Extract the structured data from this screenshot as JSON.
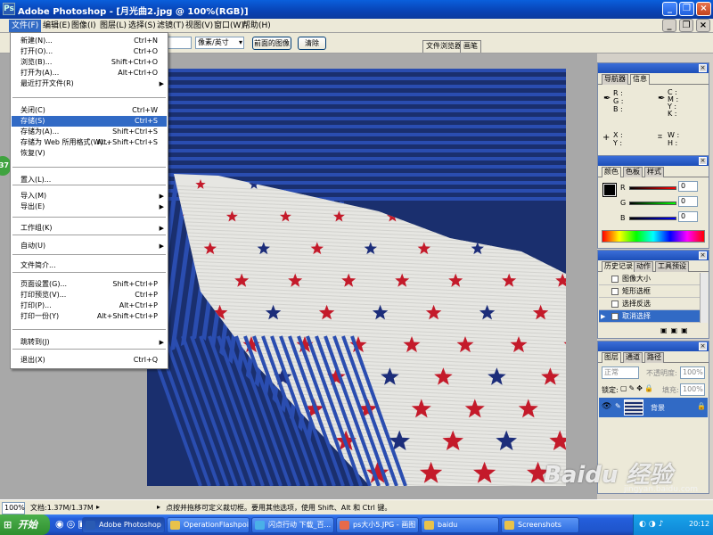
{
  "window": {
    "title": "Adobe Photoshop - [月光曲2.jpg @ 100%(RGB)]"
  },
  "menubar": [
    "文件(F)",
    "编辑(E)",
    "图像(I)",
    "图层(L)",
    "选择(S)",
    "滤镜(T)",
    "视图(V)",
    "窗口(W)",
    "帮助(H)"
  ],
  "options": {
    "res_unit": "像素/英寸",
    "front_image_label": "前面的图像",
    "clear_label": "清除"
  },
  "palette_well": [
    "文件浏览器",
    "画笔"
  ],
  "file_menu": [
    {
      "label": "新建(N)...",
      "shortcut": "Ctrl+N"
    },
    {
      "label": "打开(O)...",
      "shortcut": "Ctrl+O"
    },
    {
      "label": "浏览(B)...",
      "shortcut": "Shift+Ctrl+O"
    },
    {
      "label": "打开为(A)...",
      "shortcut": "Alt+Ctrl+O"
    },
    {
      "label": "最近打开文件(R)",
      "shortcut": ""
    },
    {
      "label": "关闭(C)",
      "shortcut": "Ctrl+W"
    },
    {
      "label": "存储(S)",
      "shortcut": "Ctrl+S"
    },
    {
      "label": "存储为(A)...",
      "shortcut": "Shift+Ctrl+S"
    },
    {
      "label": "存储为 Web 所用格式(W)...",
      "shortcut": "Alt+Shift+Ctrl+S"
    },
    {
      "label": "恢复(V)",
      "shortcut": ""
    },
    {
      "label": "置入(L)...",
      "shortcut": ""
    },
    {
      "label": "导入(M)",
      "shortcut": ""
    },
    {
      "label": "导出(E)",
      "shortcut": ""
    },
    {
      "label": "工作组(K)",
      "shortcut": ""
    },
    {
      "label": "自动(U)",
      "shortcut": ""
    },
    {
      "label": "文件简介...",
      "shortcut": ""
    },
    {
      "label": "页面设置(G)...",
      "shortcut": "Shift+Ctrl+P"
    },
    {
      "label": "打印预览(V)...",
      "shortcut": "Ctrl+P"
    },
    {
      "label": "打印(P)...",
      "shortcut": "Alt+Ctrl+P"
    },
    {
      "label": "打印一份(Y)",
      "shortcut": "Alt+Shift+Ctrl+P"
    },
    {
      "label": "跳转到(J)",
      "shortcut": ""
    },
    {
      "label": "退出(X)",
      "shortcut": "Ctrl+Q"
    }
  ],
  "side_badge": "37",
  "navigator_panel": {
    "tabs": [
      "导航器",
      "信息"
    ],
    "rgb": [
      "R :",
      "G :",
      "B :"
    ],
    "cmyk": [
      "C :",
      "M :",
      "Y :",
      "K :"
    ],
    "xy": [
      "X :",
      "Y :"
    ],
    "wh": [
      "W :",
      "H :"
    ]
  },
  "color_panel": {
    "tabs": [
      "颜色",
      "色板",
      "样式"
    ],
    "channels": [
      "R",
      "G",
      "B"
    ],
    "values": [
      "0",
      "0",
      "0"
    ]
  },
  "history_panel": {
    "tabs": [
      "历史记录",
      "动作",
      "工具预设"
    ],
    "items": [
      "图像大小",
      "矩形选框",
      "选择反选",
      "取消选择"
    ]
  },
  "layers_panel": {
    "tabs": [
      "图层",
      "通道",
      "路径"
    ],
    "blend": "正常",
    "opacity_label": "不透明度:",
    "opacity": "100%",
    "lock_label": "锁定:",
    "fill_label": "填充:",
    "fill": "100%",
    "layer_name": "背景"
  },
  "status": {
    "zoom": "100%",
    "doc": "文档:1.37M/1.37M",
    "hint": "点按并拖移可定义裁切框。要用其他选项，使用 Shift、Alt 和 Ctrl 键。"
  },
  "taskbar": {
    "start": "开始",
    "tasks": [
      "Adobe Photoshop ...",
      "OperationFlashpoint",
      "闪点行动 下载_百...",
      "ps大小5.JPG - 画图",
      "baidu",
      "Screenshots"
    ],
    "clock": "20:12"
  },
  "watermark": {
    "logo": "Baidu 经验",
    "url": "jingyan.baidu.com"
  },
  "colors": {
    "title_blue": "#0842b4",
    "select_blue": "#316ac5",
    "stripe_dark": "#1a2f6e",
    "stripe_blue": "#2a4db0",
    "star_red": "#c41a2a",
    "star_navy": "#1c2d7a"
  }
}
